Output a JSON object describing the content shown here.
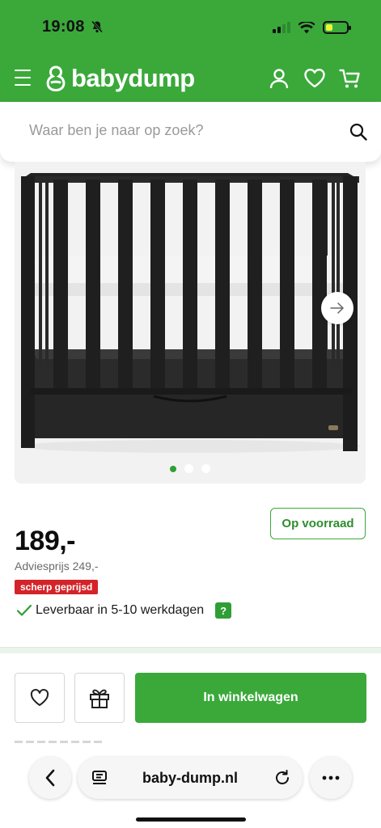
{
  "status_bar": {
    "time": "19:08",
    "battery_level": 0.35
  },
  "header": {
    "brand": "babydump",
    "icons": [
      "menu-icon",
      "account-icon",
      "heart-icon",
      "cart-icon"
    ],
    "brand_color": "#3aa93a"
  },
  "search": {
    "placeholder": "Waar ben je naar op zoek?"
  },
  "gallery": {
    "image": "black crib with white mattress",
    "slide_count": 3,
    "active_slide": 1
  },
  "product": {
    "stock_label": "Op voorraad",
    "price": "189,-",
    "advies_price": "Adviesprijs 249,-",
    "badge": "scherp geprijsd",
    "delivery": "Leverbaar in 5-10 werkdagen",
    "help": "?"
  },
  "actions": {
    "cart_label": "In winkelwagen"
  },
  "browser": {
    "url": "baby-dump.nl"
  },
  "colors": {
    "accent": "#3aa93a",
    "sale": "#d3242a"
  }
}
